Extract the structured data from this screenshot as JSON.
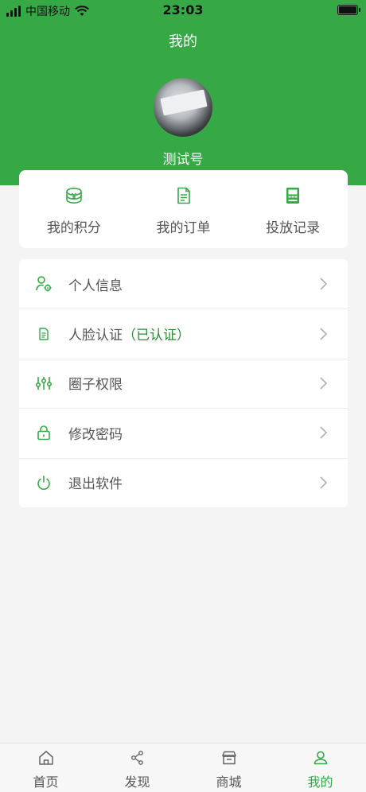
{
  "status_bar": {
    "carrier": "中国移动",
    "time": "23:03"
  },
  "header": {
    "title": "我的",
    "username": "测试号"
  },
  "stats": [
    {
      "label": "我的积分",
      "icon": "yuan-coin-icon"
    },
    {
      "label": "我的订单",
      "icon": "order-document-icon"
    },
    {
      "label": "投放记录",
      "icon": "atm-machine-icon"
    }
  ],
  "menu": [
    {
      "label": "个人信息",
      "icon": "user-settings-icon"
    },
    {
      "label": "人脸认证",
      "status": "（已认证）",
      "icon": "document-icon"
    },
    {
      "label": "圈子权限",
      "icon": "sliders-icon"
    },
    {
      "label": "修改密码",
      "icon": "lock-icon"
    },
    {
      "label": "退出软件",
      "icon": "power-icon"
    }
  ],
  "tabs": [
    {
      "label": "首页",
      "icon": "home-icon"
    },
    {
      "label": "发现",
      "icon": "share-icon"
    },
    {
      "label": "商城",
      "icon": "store-icon"
    },
    {
      "label": "我的",
      "icon": "user-icon",
      "active": true
    }
  ],
  "colors": {
    "brand_green": "#37a846",
    "verified_green": "#2e8b36",
    "background": "#f4f4f4"
  }
}
